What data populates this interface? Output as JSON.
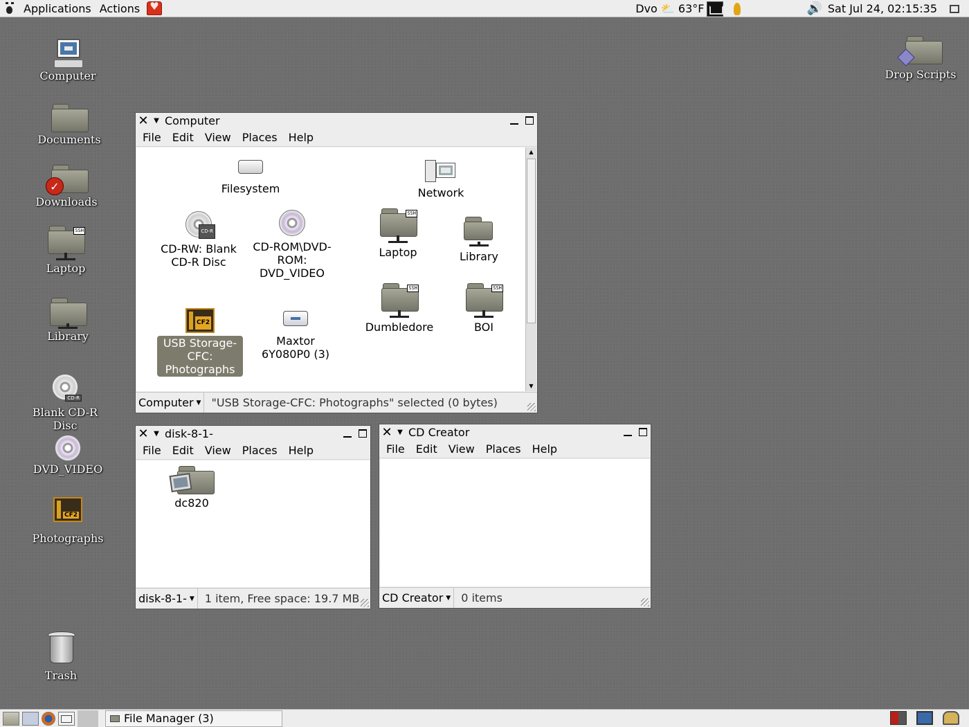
{
  "top_panel": {
    "menus": [
      "Applications",
      "Actions"
    ],
    "weather": "Dvo ⛅ 63°F",
    "clock": "Sat Jul 24, 02:15:35"
  },
  "desktop": {
    "icons": [
      {
        "label": "Computer"
      },
      {
        "label": "Documents"
      },
      {
        "label": "Downloads"
      },
      {
        "label": "Laptop"
      },
      {
        "label": "Library"
      },
      {
        "label": "Blank CD-R Disc"
      },
      {
        "label": "DVD_VIDEO"
      },
      {
        "label": "Photographs"
      },
      {
        "label": "Trash"
      },
      {
        "label": "Drop Scripts"
      }
    ]
  },
  "menubar": {
    "file": "File",
    "edit": "Edit",
    "view": "View",
    "places": "Places",
    "help": "Help"
  },
  "window_computer": {
    "title": "Computer",
    "items": [
      {
        "label": "Filesystem"
      },
      {
        "label": "Network"
      },
      {
        "label": "CD-RW: Blank CD-R Disc"
      },
      {
        "label": "CD-ROM\\DVD-ROM: DVD_VIDEO"
      },
      {
        "label": "Laptop"
      },
      {
        "label": "Library"
      },
      {
        "label": "Dumbledore"
      },
      {
        "label": "BOI"
      },
      {
        "label": "USB Storage-CFC: Photographs"
      },
      {
        "label": "Maxtor 6Y080P0 (3)"
      }
    ],
    "location": "Computer",
    "status": "\"USB Storage-CFC: Photographs\" selected (0 bytes)"
  },
  "window_disk": {
    "title": "disk-8-1-",
    "items": [
      {
        "label": "dc820"
      }
    ],
    "location": "disk-8-1-",
    "status": "1 item, Free space: 19.7 MB"
  },
  "window_cd": {
    "title": "CD Creator",
    "location": "CD Creator",
    "status": "0 items"
  },
  "bottom_panel": {
    "task": "File Manager (3)"
  },
  "ssh_tag": "SSH",
  "cdr_tag": "CD-R"
}
